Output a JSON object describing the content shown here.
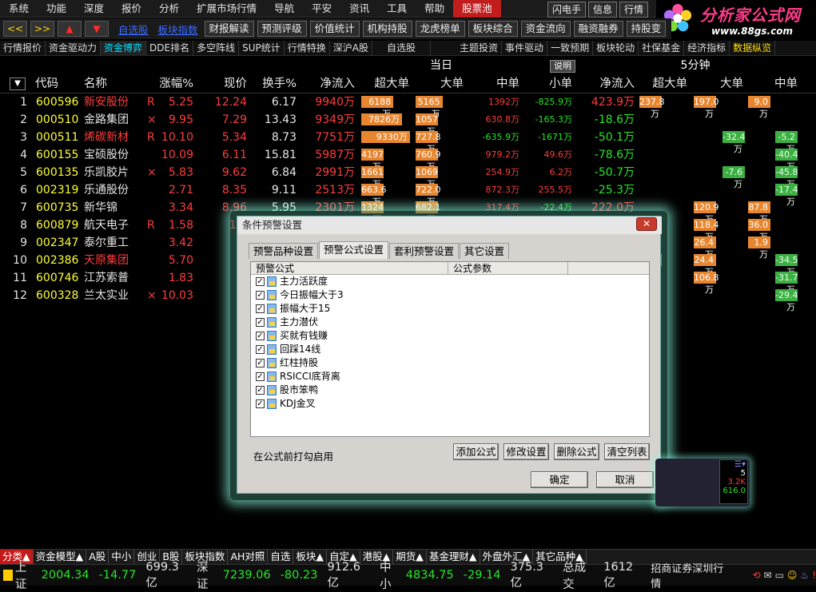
{
  "menubar": {
    "items": [
      "系统",
      "功能",
      "深度",
      "报价",
      "分析",
      "扩展市场行情",
      "导航",
      "平安",
      "资讯",
      "工具",
      "帮助",
      "股票池"
    ],
    "right_buttons": [
      "闪电手",
      "信息",
      "行情"
    ]
  },
  "logo": {
    "name": "分析家公式网",
    "url": "www.88gs.com"
  },
  "toolbar": {
    "nav": [
      "<<",
      ">>",
      "▲",
      "▼"
    ],
    "links": [
      "自选股",
      "板块指数"
    ],
    "buttons": [
      "财报解读",
      "预测评级",
      "价值统计",
      "机构持股",
      "龙虎榜单",
      "板块综合",
      "资金流向",
      "融资融券",
      "持股变"
    ]
  },
  "subtabs": [
    "行情报价",
    "资金驱动力",
    "资金博弈",
    "DDE排名",
    "多空阵线",
    "SUP统计",
    "行情特换",
    "深沪A股",
    "自选股",
    "主题投资",
    "事件驱动",
    "一致预期",
    "板块轮动",
    "社保基金",
    "经济指标",
    "数据纵览"
  ],
  "header": {
    "group_today": "当日",
    "group_5min": "5分钟",
    "explain": "说明",
    "cols": [
      "代码",
      "名称",
      "涨幅%",
      "现价",
      "换手%",
      "净流入",
      "超大单",
      "大单",
      "中单",
      "小单",
      "净流入",
      "超大单",
      "大单",
      "中单"
    ]
  },
  "rows": [
    {
      "n": "1",
      "code": "600596",
      "name": "新安股份",
      "mark": "R",
      "pct": "5.25",
      "price": "12.24",
      "turn": "6.17",
      "net": "9940万",
      "xl": "6188万",
      "l": "5165万",
      "m": "1392万",
      "s": "-825.9万",
      "net5": "423.9万",
      "xl5": "237.8万",
      "l5": "197.0万",
      "m5": "9.0万"
    },
    {
      "n": "2",
      "code": "000510",
      "name": "金路集团",
      "mark": "×",
      "pct": "9.95",
      "price": "7.29",
      "turn": "13.43",
      "net": "9349万",
      "xl": "7826万",
      "l": "1057万",
      "m": "630.8万",
      "s": "-165.3万",
      "net5": "-18.6万",
      "xl5": "",
      "l5": "",
      "m5": ""
    },
    {
      "n": "3",
      "code": "000511",
      "name": "烯碳新材",
      "mark": "R",
      "pct": "10.10",
      "price": "5.34",
      "turn": "8.73",
      "net": "7751万",
      "xl": "9330万",
      "l": "727.8万",
      "m": "-635.9万",
      "s": "-1671万",
      "net5": "-50.1万",
      "xl5": "",
      "l5": "-32.4万",
      "m5": "-5.2万"
    },
    {
      "n": "4",
      "code": "600155",
      "name": "宝硕股份",
      "mark": "",
      "pct": "10.09",
      "price": "6.11",
      "turn": "15.81",
      "net": "5987万",
      "xl": "4197万",
      "l": "760.9万",
      "m": "979.2万",
      "s": "49.6万",
      "net5": "-78.6万",
      "xl5": "",
      "l5": "",
      "m5": "-40.4万"
    },
    {
      "n": "5",
      "code": "600135",
      "name": "乐凯胶片",
      "mark": "×",
      "pct": "5.83",
      "price": "9.62",
      "turn": "6.84",
      "net": "2991万",
      "xl": "1661万",
      "l": "1069万",
      "m": "254.9万",
      "s": "6.2万",
      "net5": "-50.7万",
      "xl5": "",
      "l5": "-7.6万",
      "m5": "-45.8万"
    },
    {
      "n": "6",
      "code": "002319",
      "name": "乐通股份",
      "mark": "",
      "pct": "2.71",
      "price": "8.35",
      "turn": "9.11",
      "net": "2513万",
      "xl": "663.6万",
      "l": "722.0万",
      "m": "872.3万",
      "s": "255.5万",
      "net5": "-25.3万",
      "xl5": "",
      "l5": "",
      "m5": "-17.4万"
    },
    {
      "n": "7",
      "code": "600735",
      "name": "新华锦",
      "mark": "",
      "pct": "3.34",
      "price": "8.96",
      "turn": "5.95",
      "net": "2301万",
      "xl": "1324万",
      "l": "682.1万",
      "m": "317.4万",
      "s": "-22.4万",
      "net5": "222.0万",
      "xl5": "",
      "l5": "120.9万",
      "m5": "87.8万"
    },
    {
      "n": "8",
      "code": "600879",
      "name": "航天电子",
      "mark": "R",
      "pct": "1.58",
      "price": "10.",
      "turn": "",
      "net": "",
      "xl": "",
      "l": "",
      "m": "",
      "s": "",
      "net5": "",
      "xl5": "54.0万",
      "l5": "118.4万",
      "m5": "36.0万"
    },
    {
      "n": "9",
      "code": "002347",
      "name": "泰尔重工",
      "mark": "",
      "pct": "3.42",
      "price": "8.",
      "turn": "",
      "net": "",
      "xl": "",
      "l": "",
      "m": "",
      "s": "",
      "net5": "",
      "xl5": "",
      "l5": "26.4万",
      "m5": "1.9万"
    },
    {
      "n": "10",
      "code": "002386",
      "name": "天原集团",
      "mark": "",
      "pct": "5.70",
      "price": "8.",
      "turn": "",
      "net": "",
      "xl": "",
      "l": "",
      "m": "",
      "s": "",
      "net5": "",
      "xl5": "3.2万",
      "l5": "24.4万",
      "m5": "-34.5万"
    },
    {
      "n": "11",
      "code": "600746",
      "name": "江苏索普",
      "mark": "",
      "pct": "1.83",
      "price": "7.",
      "turn": "",
      "net": "",
      "xl": "",
      "l": "",
      "m": "",
      "s": "",
      "net5": "",
      "xl5": "",
      "l5": "106.8万",
      "m5": "-31.7万"
    },
    {
      "n": "12",
      "code": "600328",
      "name": "兰太实业",
      "mark": "×",
      "pct": "10.03",
      "price": "8.",
      "turn": "",
      "net": "",
      "xl": "",
      "l": "",
      "m": "",
      "s": "",
      "net5": "",
      "xl5": "",
      "l5": "",
      "m5": "-29.4万"
    }
  ],
  "dialog": {
    "title": "条件预警设置",
    "tabs": [
      "预警品种设置",
      "预警公式设置",
      "套利预警设置",
      "其它设置"
    ],
    "col_formula": "预警公式",
    "col_param": "公式参数",
    "formulas": [
      "主力活跃度",
      "今日振幅大于3",
      "振幅大于15",
      "主力潜伏",
      "买就有钱赚",
      "回踩14线",
      "红柱持股",
      "RSICCI底背离",
      "股市笨鸭",
      "KDJ金叉"
    ],
    "hint": "在公式前打勾启用",
    "btn_add": "添加公式",
    "btn_modify": "修改设置",
    "btn_delete": "删除公式",
    "btn_clear": "清空列表",
    "btn_ok": "确定",
    "btn_cancel": "取消"
  },
  "mini": {
    "v1": "5",
    "v2": "3.2K",
    "v3": "616.0"
  },
  "bottom_tabs": [
    "分类▲",
    "资金模型▲",
    "A股",
    "中小",
    "创业",
    "B股",
    "板块指数",
    "AH对照",
    "自选",
    "板块▲",
    "自定▲",
    "港股▲",
    "期货▲",
    "基金理财▲",
    "外盘外汇▲",
    "其它品种▲"
  ],
  "status": {
    "sh_label": "上证",
    "sh_idx": "2004.34",
    "sh_chg": "-14.77",
    "sh_amt": "699.3亿",
    "sz_label": "深证",
    "sz_idx": "7239.06",
    "sz_chg": "-80.23",
    "sz_amt": "912.6亿",
    "zx_label": "中小",
    "zx_idx": "4834.75",
    "zx_chg": "-29.14",
    "zx_amt": "375.3亿",
    "total_label": "总成交",
    "total": "1612亿",
    "broker": "招商证券深圳行情"
  },
  "colors": {
    "up": "#ff3d3d",
    "down": "#28e528",
    "bar_buy": "#e8862f",
    "bar_sell": "#3cb043",
    "accent": "#00e0ff"
  }
}
